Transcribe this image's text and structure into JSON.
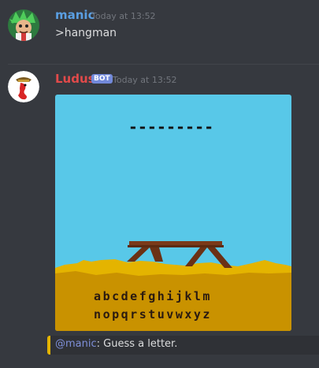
{
  "messages": [
    {
      "username": "manic",
      "username_color": "#5a9fe3",
      "timestamp": "Today at 13:52",
      "content": ">hangman"
    },
    {
      "username": "Ludus",
      "username_color": "#e24a4a",
      "badge": "BOT",
      "timestamp": "Today at 13:52",
      "image": {
        "word_mask": "---------",
        "alphabet_row1": "abcdefghijklm",
        "alphabet_row2": "nopqrstuvwxyz",
        "sky_color": "#58c8e8",
        "ground_color": "#c99200"
      },
      "embed": {
        "mention": "@manic",
        "text": ": Guess a letter.",
        "border_color": "#e4b400"
      }
    }
  ]
}
